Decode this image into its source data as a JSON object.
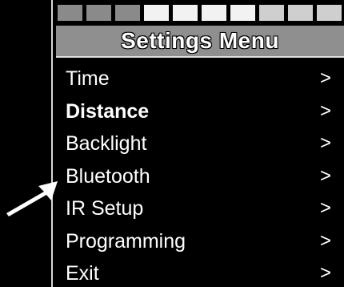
{
  "screen": {
    "segments": [
      {
        "color": "#8a8a8a"
      },
      {
        "color": "#8a8a8a"
      },
      {
        "color": "#8a8a8a"
      },
      {
        "color": "#f2f2f2"
      },
      {
        "color": "#f2f2f2"
      },
      {
        "color": "#f2f2f2"
      },
      {
        "color": "#f2f2f2"
      },
      {
        "color": "#cfcfcf"
      },
      {
        "color": "#cfcfcf"
      },
      {
        "color": "#cfcfcf"
      }
    ],
    "title": "Settings Menu",
    "title_bg": "#8f8f8f"
  },
  "menu": {
    "items": [
      {
        "label": "Time",
        "chevron": ">",
        "emphasis": false
      },
      {
        "label": "Distance",
        "chevron": ">",
        "emphasis": true
      },
      {
        "label": "Backlight",
        "chevron": ">",
        "emphasis": false
      },
      {
        "label": "Bluetooth",
        "chevron": ">",
        "emphasis": false
      },
      {
        "label": "IR Setup",
        "chevron": ">",
        "emphasis": false
      },
      {
        "label": "Programming",
        "chevron": ">",
        "emphasis": false
      },
      {
        "label": "Exit",
        "chevron": ">",
        "emphasis": false
      }
    ]
  },
  "pointer": {
    "icon": "arrow-pointer-icon",
    "color": "#ffffff",
    "points_to": "Bluetooth"
  }
}
